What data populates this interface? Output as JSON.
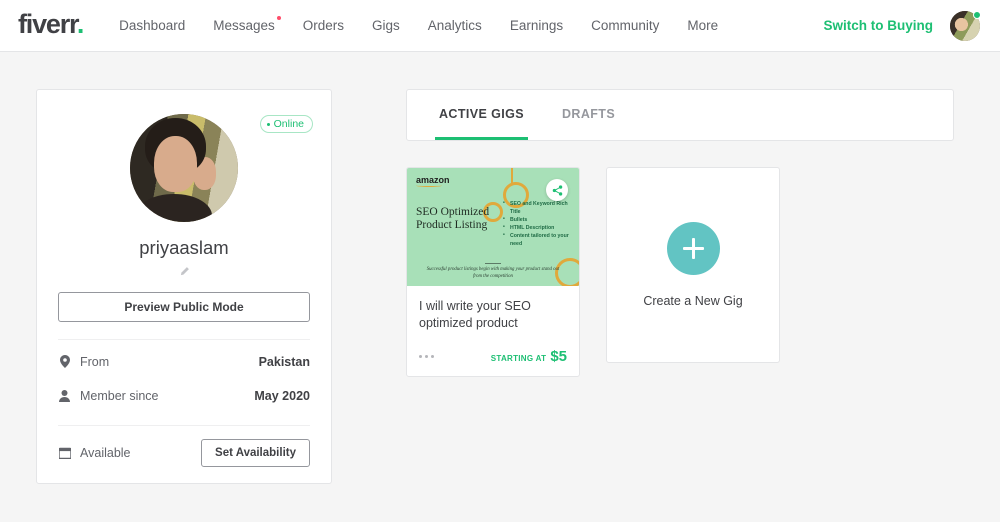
{
  "header": {
    "logo_text": "fiverr",
    "logo_dot": ".",
    "nav": [
      {
        "label": "Dashboard",
        "has_dot": false
      },
      {
        "label": "Messages",
        "has_dot": true
      },
      {
        "label": "Orders",
        "has_dot": false
      },
      {
        "label": "Gigs",
        "has_dot": false
      },
      {
        "label": "Analytics",
        "has_dot": false
      },
      {
        "label": "Earnings",
        "has_dot": false
      },
      {
        "label": "Community",
        "has_dot": false
      },
      {
        "label": "More",
        "has_dot": false
      }
    ],
    "switch_link": "Switch to Buying",
    "avatar_name": "user-avatar"
  },
  "profile": {
    "online_label": "Online",
    "username": "priyaaslam",
    "edit_icon": "pencil-icon",
    "preview_button": "Preview Public Mode",
    "details": [
      {
        "icon": "location-pin-icon",
        "label": "From",
        "value": "Pakistan"
      },
      {
        "icon": "person-icon",
        "label": "Member since",
        "value": "May 2020"
      }
    ],
    "availability": {
      "icon": "calendar-icon",
      "label": "Available",
      "button": "Set Availability"
    }
  },
  "gigs": {
    "tabs": [
      {
        "label": "ACTIVE GIGS",
        "active": true
      },
      {
        "label": "DRAFTS",
        "active": false
      }
    ],
    "cards": [
      {
        "thumbnail": {
          "brand": "amazon",
          "title": "SEO Optimized Product Listing",
          "bullets": [
            "SEO and Keyword Rich Title",
            "Bullets",
            "HTML Description",
            "Content tailored to your need"
          ],
          "tagline": "Successful product listings begin with making your product stand out from the competition",
          "share_icon": "share-icon",
          "bg_color": "#a8e0b8",
          "accent_color": "#e0a93c"
        },
        "title": "I will write your SEO optimized product",
        "menu_icon": "more-dots-icon",
        "price_label": "STARTING AT",
        "price_value": "$5"
      }
    ],
    "new_gig": {
      "icon": "plus-icon",
      "label": "Create a New Gig",
      "circle_color": "#62c4c3"
    }
  },
  "colors": {
    "brand_green": "#1dbf73",
    "page_bg": "#f5f5f5",
    "card_border": "#e4e5e7",
    "notification_dot": "#ff4d6a"
  }
}
